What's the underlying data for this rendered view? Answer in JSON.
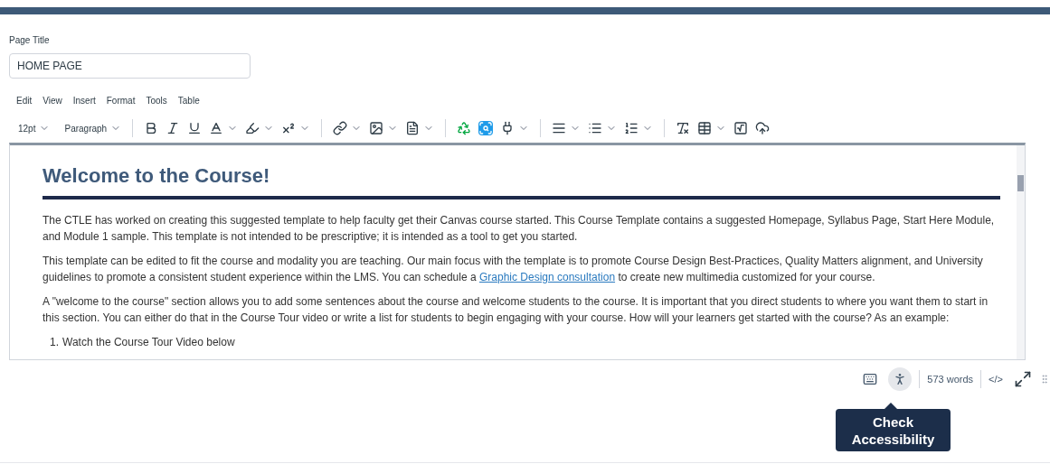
{
  "page_title": {
    "label": "Page Title",
    "value": "HOME PAGE"
  },
  "menu": [
    "Edit",
    "View",
    "Insert",
    "Format",
    "Tools",
    "Table"
  ],
  "toolbar": {
    "font_size": "12pt",
    "block_format": "Paragraph"
  },
  "content": {
    "heading": "Welcome to the Course!",
    "paragraphs": [
      {
        "before": "The CTLE has worked on creating this suggested template to help faculty get their Canvas course started. This Course Template contains a suggested Homepage, Syllabus Page, Start Here Module, and Module 1 sample. This template is not intended to be prescriptive; it is intended as a tool to get you started."
      },
      {
        "before": "This template can be edited to fit the course and modality you are teaching. Our main focus with the template is to promote Course Design Best-Practices, Quality Matters alignment, and University guidelines to promote a consistent student experience within the LMS. You can schedule a ",
        "link": "Graphic Design consultation",
        "after": " to create new multimedia customized for your course."
      },
      {
        "before": "A \"welcome to the course\" section allows you to add some sentences about the course and welcome students to the course. It is important that you direct students to where you want them to start in this section.  You can either do that in the Course Tour video or write a list for students to begin engaging with your course.  How will your learners get started with the course? As an example:"
      }
    ],
    "list": [
      {
        "number": "1.",
        "text": "Watch the Course Tour Video below"
      }
    ]
  },
  "status_bar": {
    "word_count": "573 words",
    "html_toggle": "</>"
  },
  "tooltip": {
    "text": "Check Accessibility"
  }
}
